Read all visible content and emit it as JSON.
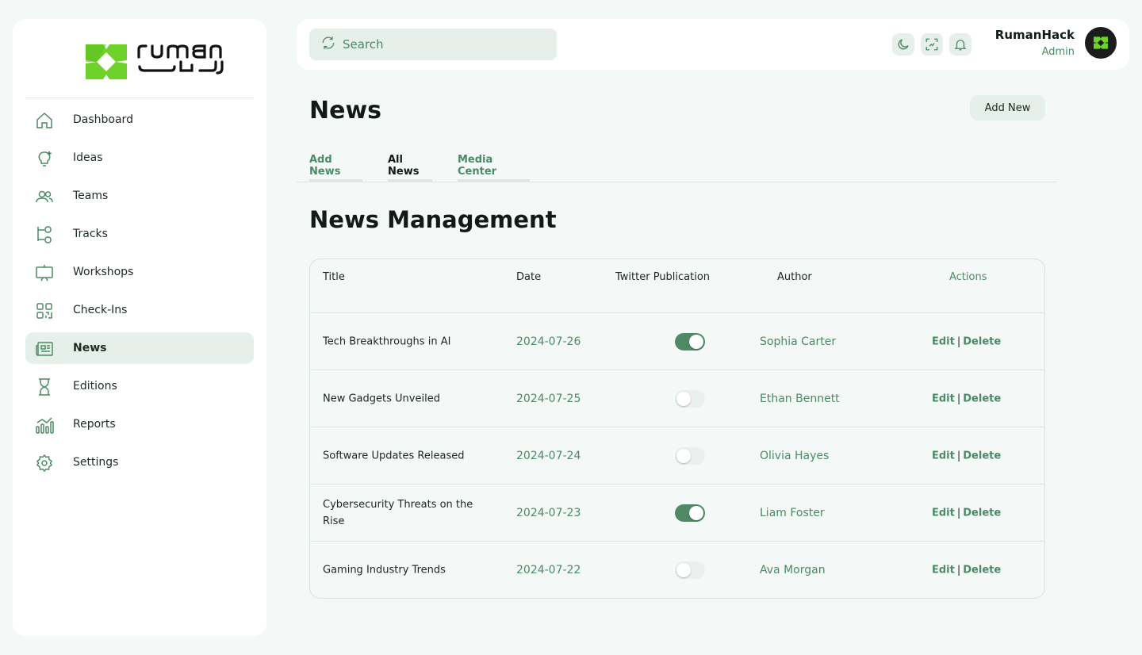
{
  "brand": {
    "name": "ruman"
  },
  "sidebar": {
    "items": [
      {
        "label": "Dashboard",
        "icon": "home-icon"
      },
      {
        "label": "Ideas",
        "icon": "lightbulb-icon"
      },
      {
        "label": "Teams",
        "icon": "users-icon"
      },
      {
        "label": "Tracks",
        "icon": "tracks-icon"
      },
      {
        "label": "Workshops",
        "icon": "presentation-icon"
      },
      {
        "label": "Check-Ins",
        "icon": "qr-code-icon"
      },
      {
        "label": "News",
        "icon": "newspaper-icon",
        "active": true
      },
      {
        "label": "Editions",
        "icon": "hourglass-icon"
      },
      {
        "label": "Reports",
        "icon": "chart-icon"
      },
      {
        "label": "Settings",
        "icon": "gear-icon"
      }
    ]
  },
  "topbar": {
    "search_placeholder": "Search",
    "user_name": "RumanHack",
    "user_role": "Admin"
  },
  "page": {
    "title": "News",
    "add_new_label": "Add New",
    "section_title": "News Management"
  },
  "tabs": [
    {
      "label": "Add News",
      "active": false
    },
    {
      "label": "All News",
      "active": true
    },
    {
      "label": "Media Center",
      "active": false
    }
  ],
  "table": {
    "headers": {
      "title": "Title",
      "date": "Date",
      "twitter": "Twitter Publication",
      "author": "Author",
      "actions": "Actions"
    },
    "edit_label": "Edit",
    "delete_label": "Delete",
    "rows": [
      {
        "title": "Tech Breakthroughs in AI",
        "date": "2024-07-26",
        "twitter": true,
        "author": "Sophia Carter"
      },
      {
        "title": "New Gadgets Unveiled",
        "date": "2024-07-25",
        "twitter": false,
        "author": "Ethan Bennett"
      },
      {
        "title": "Software Updates Released",
        "date": "2024-07-24",
        "twitter": false,
        "author": "Olivia Hayes"
      },
      {
        "title": "Cybersecurity Threats on the Rise",
        "date": "2024-07-23",
        "twitter": true,
        "author": "Liam Foster"
      },
      {
        "title": "Gaming Industry Trends",
        "date": "2024-07-22",
        "twitter": false,
        "author": "Ava Morgan"
      }
    ]
  },
  "colors": {
    "accent": "#4a8a66",
    "brand_green": "#6fd22b",
    "toggle_on": "#4e8a65"
  }
}
